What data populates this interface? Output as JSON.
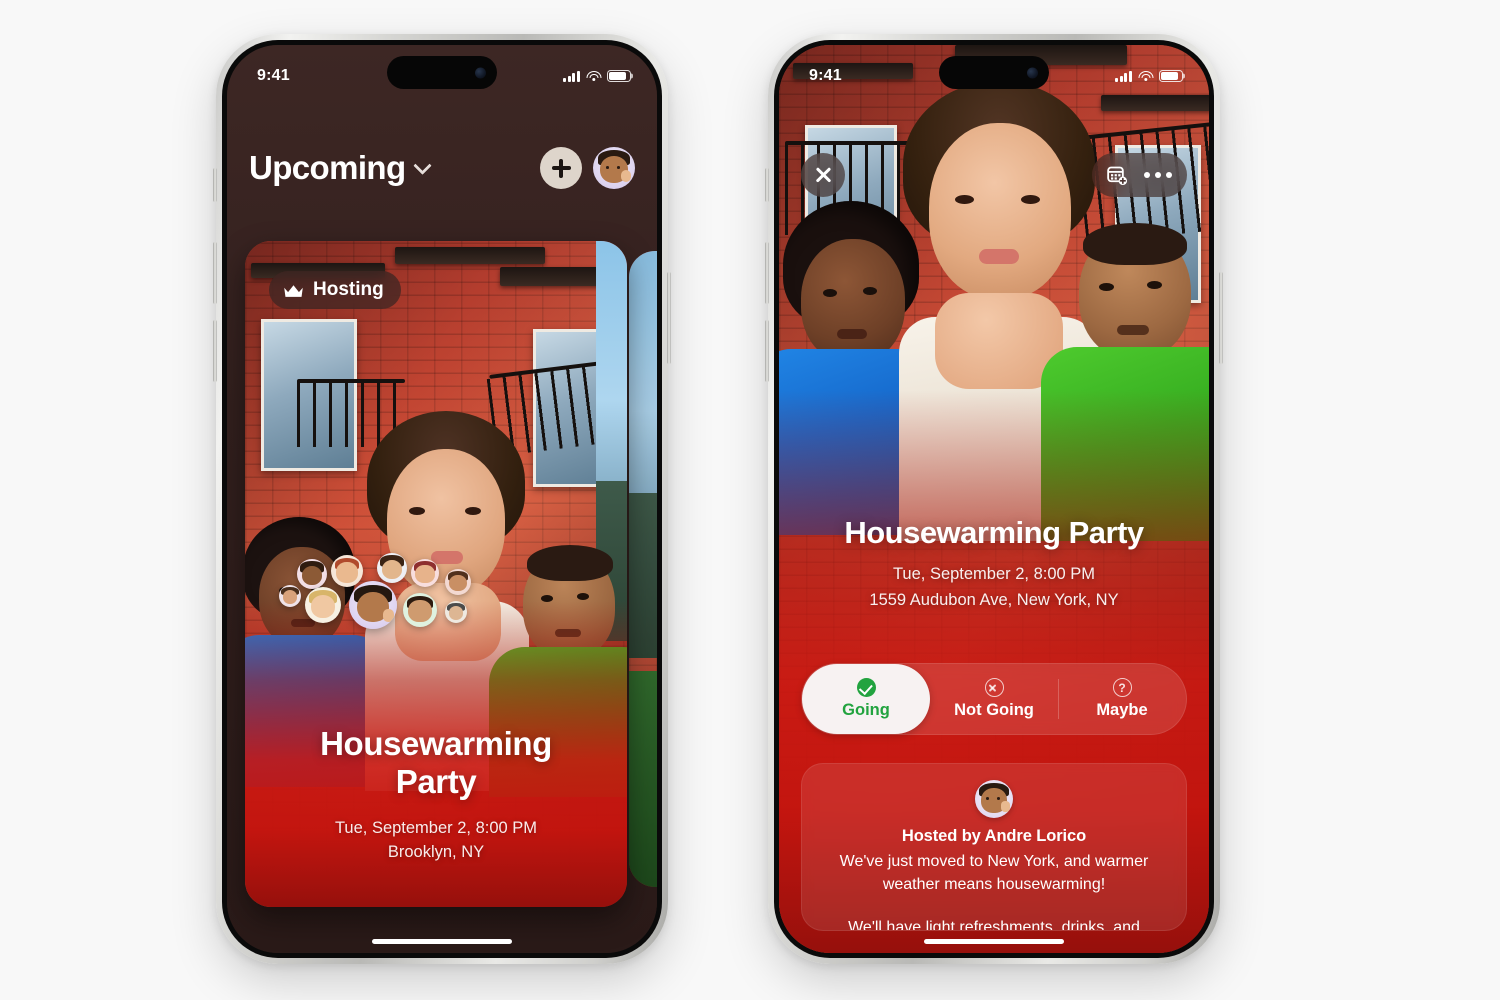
{
  "canvas": {
    "background": "#f8f8f8"
  },
  "theme": {
    "accent_green": "#22a33f",
    "card_red": "#c4140e",
    "nav_chrome": "#ded5cb",
    "app_background": "#33201e"
  },
  "phones": [
    {
      "id": "left-phone",
      "status_bar": {
        "time": "9:41",
        "icons": [
          "cellular-signal-icon",
          "wifi-icon",
          "battery-icon"
        ]
      },
      "nav": {
        "title": "Upcoming",
        "chevron": "chevron-down-icon",
        "add_button": "plus-icon",
        "profile_avatar": "memoji-avatar"
      },
      "card": {
        "badge": {
          "icon": "crown-icon",
          "label": "Hosting"
        },
        "title_line1": "Housewarming",
        "title_line2": "Party",
        "date": "Tue, September 2, 8:00 PM",
        "location": "Brooklyn, NY",
        "attendee_count": 10
      },
      "home_indicator": true
    },
    {
      "id": "right-phone",
      "status_bar": {
        "time": "9:41",
        "icons": [
          "cellular-signal-icon",
          "wifi-icon",
          "battery-icon"
        ]
      },
      "toolbar": {
        "close": "close-icon",
        "add_to_calendar": "calendar-add-icon",
        "more": "more-dots-icon"
      },
      "detail": {
        "title": "Housewarming Party",
        "date": "Tue, September 2, 8:00 PM",
        "address": "1559 Audubon Ave, New York, NY"
      },
      "rsvp": {
        "selected": "Going",
        "options": [
          {
            "label": "Going",
            "icon": "check-circle-icon",
            "selected": true
          },
          {
            "label": "Not Going",
            "icon": "x-circle-icon",
            "selected": false
          },
          {
            "label": "Maybe",
            "icon": "question-circle-icon",
            "selected": false
          }
        ]
      },
      "host_card": {
        "avatar": "host-memoji-avatar",
        "host_line": "Hosted by Andre Lorico",
        "paragraph1": "We've just moved to New York, and warmer weather means housewarming!",
        "paragraph2": "We'll have light refreshments, drinks, and BBQ'ing in the evening. Come by to hang out, catch up, and meet friends!"
      },
      "home_indicator": true
    }
  ]
}
